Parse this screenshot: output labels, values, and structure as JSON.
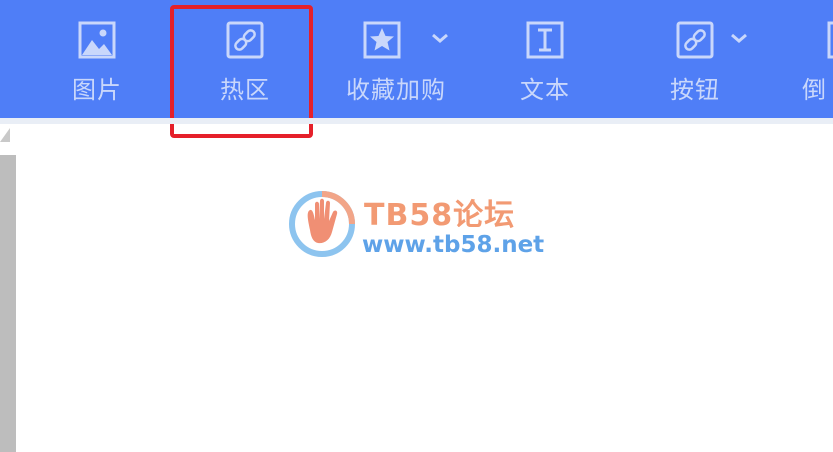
{
  "toolbar": {
    "items": [
      {
        "label": "图片",
        "icon": "image-icon"
      },
      {
        "label": "热区",
        "icon": "link-hotspot-icon"
      },
      {
        "label": "收藏加购",
        "icon": "star-icon"
      },
      {
        "label": "文本",
        "icon": "text-icon"
      },
      {
        "label": "按钮",
        "icon": "link-button-icon"
      },
      {
        "label": "倒",
        "icon": "countdown-icon"
      }
    ],
    "selected": "热区"
  },
  "watermark": {
    "title": "TB58论坛",
    "url": "www.tb58.net"
  },
  "colors": {
    "toolbar_bg": "#4f7ef7",
    "highlight_border": "#e5202a",
    "watermark_title": "#f29a73",
    "watermark_url": "#5ea2e8"
  }
}
